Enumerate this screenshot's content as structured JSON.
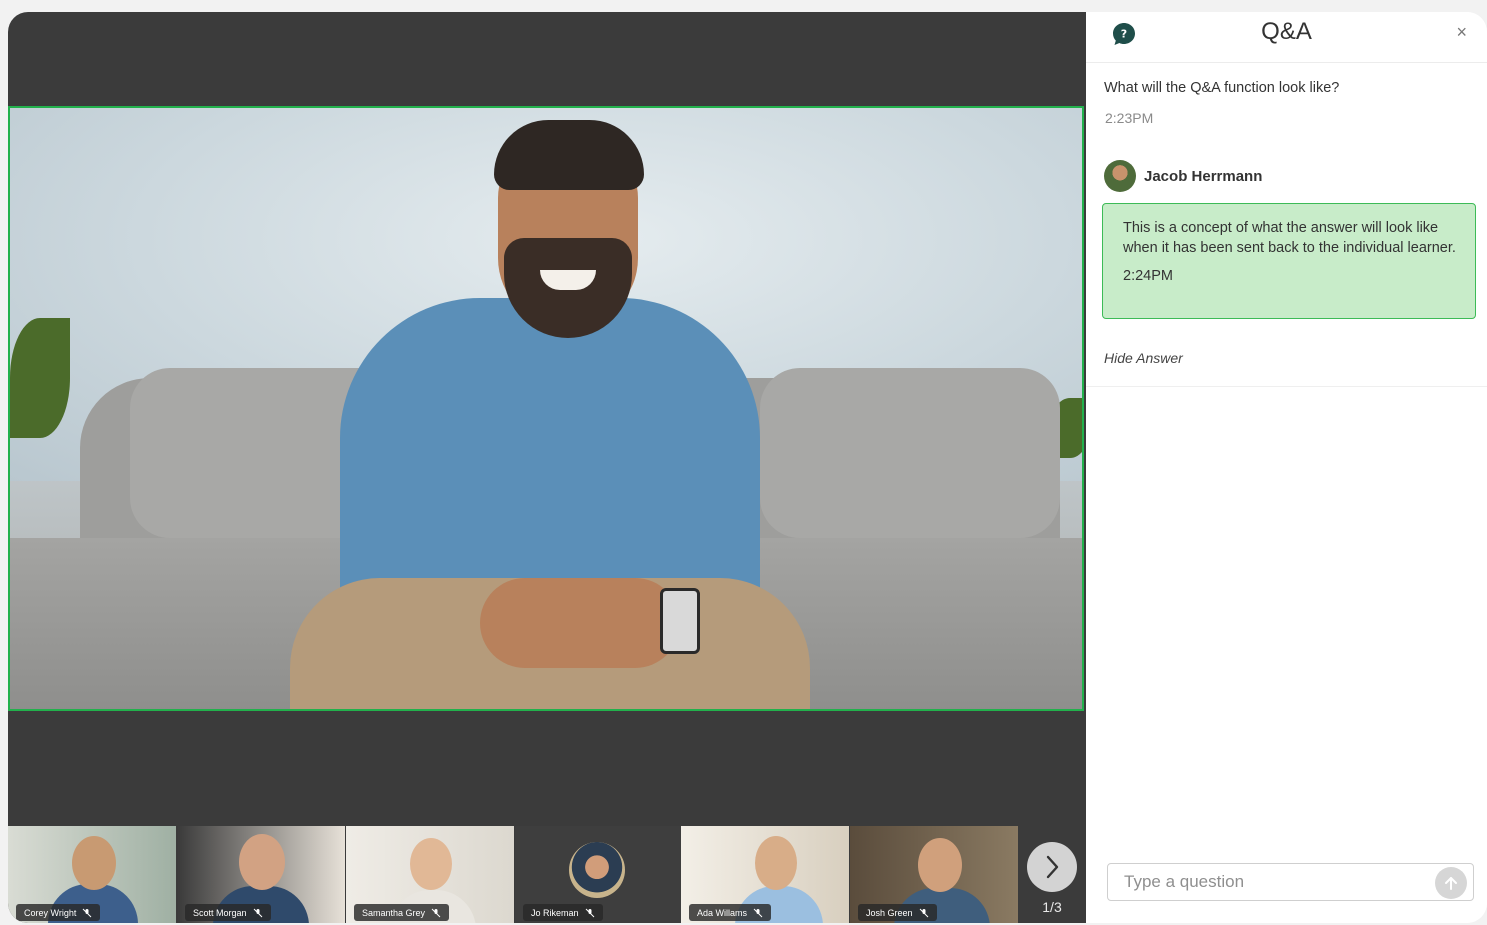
{
  "qa_panel": {
    "title": "Q&A",
    "close_label": "×",
    "question_text": "What will the Q&A function look like?",
    "question_time": "2:23PM",
    "answerer_name": "Jacob Herrmann",
    "answer_text": "This is a concept of what the answer will look like when it has been sent back to the individual learner.",
    "answer_time": "2:24PM",
    "hide_answer_label": "Hide Answer",
    "input_placeholder": "Type a question"
  },
  "participants": [
    {
      "name": "Corey Wright"
    },
    {
      "name": "Scott Morgan"
    },
    {
      "name": "Samantha Grey"
    },
    {
      "name": "Jo Rikeman"
    },
    {
      "name": "Ada Willams"
    },
    {
      "name": "Josh Green"
    }
  ],
  "pagination": {
    "label": "1/3"
  },
  "colors": {
    "active_speaker_border": "#22b14c",
    "answer_bg": "#c8ecc9",
    "answer_border": "#3dbb57",
    "stage_bg": "#3b3b3b"
  }
}
